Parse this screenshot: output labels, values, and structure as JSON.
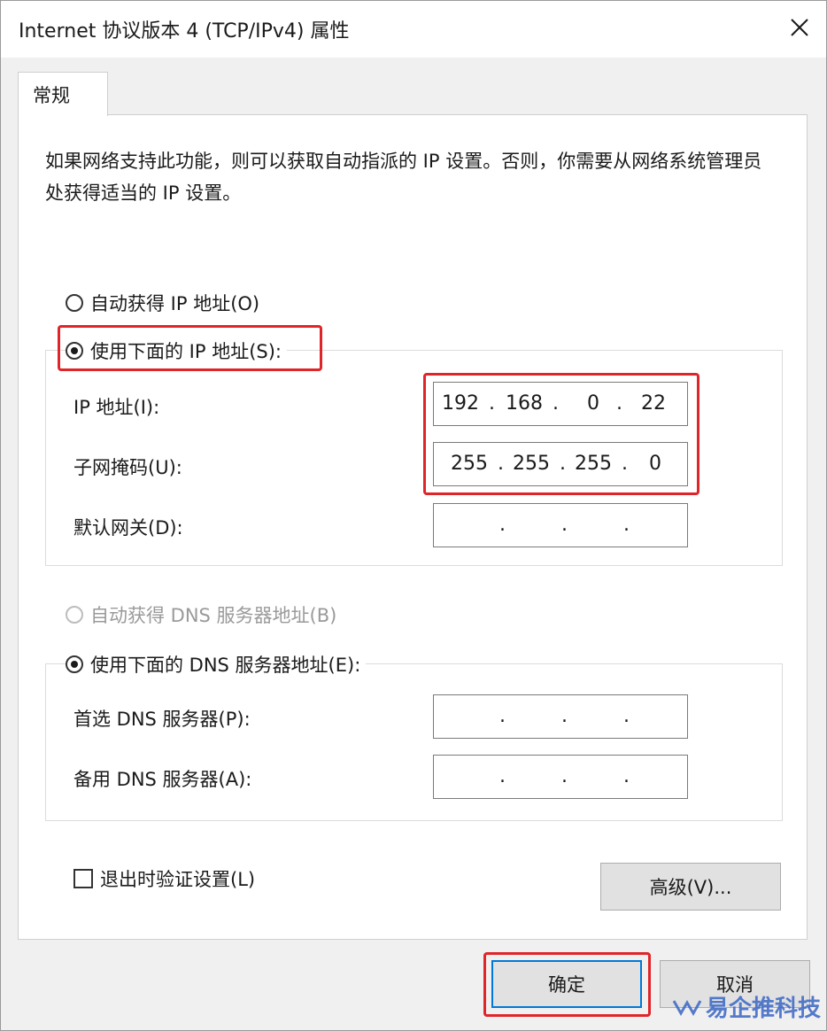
{
  "window": {
    "title": "Internet 协议版本 4 (TCP/IPv4) 属性",
    "close_icon": "close-icon"
  },
  "tabs": [
    {
      "label": "常规",
      "selected": true
    }
  ],
  "description": "如果网络支持此功能，则可以获取自动指派的 IP 设置。否则，你需要从网络系统管理员处获得适当的 IP 设置。",
  "ip_mode": {
    "auto_label": "自动获得 IP 地址(O)",
    "manual_label": "使用下面的 IP 地址(S):",
    "selected": "manual"
  },
  "ip_fields": [
    {
      "label": "IP 地址(I):",
      "octets": [
        "192",
        "168",
        "0",
        "22"
      ]
    },
    {
      "label": "子网掩码(U):",
      "octets": [
        "255",
        "255",
        "255",
        "0"
      ]
    },
    {
      "label": "默认网关(D):",
      "octets": [
        "",
        "",
        "",
        ""
      ]
    }
  ],
  "dns_mode": {
    "auto_label": "自动获得 DNS 服务器地址(B)",
    "auto_disabled": true,
    "manual_label": "使用下面的 DNS 服务器地址(E):",
    "selected": "manual"
  },
  "dns_fields": [
    {
      "label": "首选 DNS 服务器(P):",
      "octets": [
        "",
        "",
        "",
        ""
      ]
    },
    {
      "label": "备用 DNS 服务器(A):",
      "octets": [
        "",
        "",
        "",
        ""
      ]
    }
  ],
  "validate_on_exit": {
    "label": "退出时验证设置(L)",
    "checked": false
  },
  "buttons": {
    "advanced": "高级(V)...",
    "ok": "确定",
    "cancel": "取消"
  },
  "watermark": "易企推科技",
  "colors": {
    "highlight": "#e0252a",
    "focus": "#0078d7"
  }
}
